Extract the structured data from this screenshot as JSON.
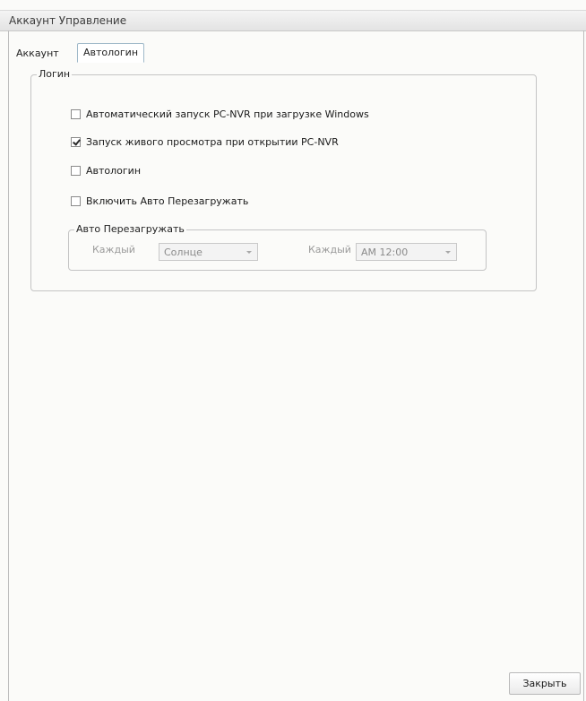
{
  "window": {
    "title": "Аккаунт Управление"
  },
  "tabs": [
    {
      "label": "Аккаунт",
      "active": false
    },
    {
      "label": "Автологин",
      "active": true
    }
  ],
  "login_group": {
    "legend": "Логин",
    "options": [
      {
        "label": "Автоматический запуск PC-NVR при загрузке Windows",
        "checked": false
      },
      {
        "label": "Запуск живого просмотра при открытии PC-NVR",
        "checked": true
      },
      {
        "label": "Автологин",
        "checked": false
      },
      {
        "label": "Включить Авто Перезагружать",
        "checked": false
      }
    ]
  },
  "reboot_group": {
    "legend": "Авто Перезагружать",
    "day_label": "Каждый",
    "day_value": "Солнце",
    "time_label": "Каждый",
    "time_value": "AM 12:00"
  },
  "footer": {
    "close_label": "Закрыть"
  }
}
